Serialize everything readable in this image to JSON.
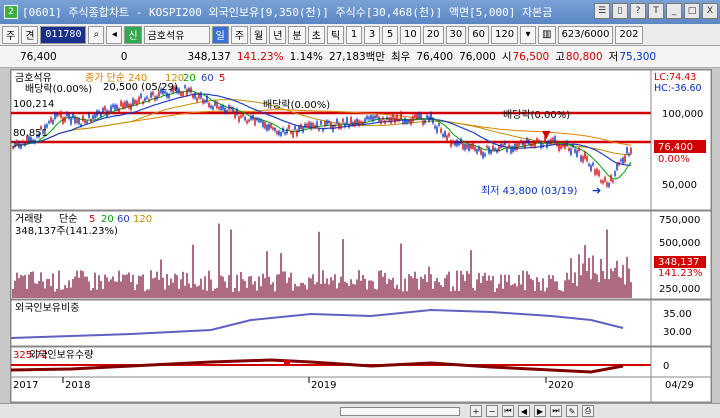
{
  "window": {
    "title": "[0601] 주식종합차트 - KOSPI200 외국인보유[9,350(천)] 주식수[30,468(천)] 액면[5,000] 자본금",
    "buttons": [
      "☰",
      "▯",
      "?",
      "T",
      "_",
      "□",
      "X"
    ]
  },
  "toolbar": {
    "market": "주",
    "mode": "견",
    "code": "011780",
    "flag": "신",
    "stock_name": "금호석유",
    "periods": [
      "일",
      "주",
      "월",
      "년",
      "분",
      "초",
      "틱"
    ],
    "active_period": "일",
    "intervals": [
      "1",
      "3",
      "5",
      "10",
      "20",
      "30",
      "60",
      "120"
    ],
    "count": "623",
    "count_max": "/6000",
    "right_label": "202"
  },
  "info": {
    "price": "76,400",
    "change": "0",
    "volume": "348,137",
    "volume_pct": "141.23%",
    "turnover": "1.14%",
    "amount": "27,183백만",
    "last_label": "최우",
    "last": "76,400",
    "last2": "76,000",
    "open_label": "시",
    "open": "76,500",
    "high_label": "고",
    "high": "80,800",
    "low_label": "저",
    "low": "75,300"
  },
  "panels": {
    "price": {
      "legend_name": "금호석유",
      "legend_ma_label": "종가 단순 240",
      "legend_ma": [
        "120",
        "20",
        "60",
        "5"
      ],
      "left_labels": [
        "100,214",
        "80,851"
      ],
      "annotations": {
        "div1": "배당락(0.00%)",
        "div1_val": "20,500 (05/29)",
        "div2": "배당락(0.00%)",
        "div3": "배당락(0.00%)",
        "low": "최저 43,800 (03/19)"
      },
      "right_labels": [
        "LC:74.43",
        "HC:-36.60",
        "100,000",
        "76,400",
        "0.00%",
        "50,000"
      ]
    },
    "volume": {
      "legend_name": "거래량",
      "legend_ma_label": "단순",
      "legend_ma": [
        "5",
        "20",
        "60",
        "120"
      ],
      "value_label": "348,137주(141.23%)",
      "right_labels": [
        "750,000",
        "500,000",
        "348,137",
        "141.23%",
        "250,000"
      ]
    },
    "foreign_pct": {
      "legend_name": "외국인보유비중",
      "right_labels": [
        "35.00",
        "30.00"
      ]
    },
    "foreign_qty": {
      "legend_name": "외국인보유수량",
      "left_label": "325.72",
      "right_labels": [
        "0"
      ]
    }
  },
  "x_axis": [
    "2017",
    "2018",
    "2019",
    "2020",
    "04/29"
  ],
  "colors": {
    "up": "#d00000",
    "down": "#0030c0",
    "ma5": "#d00000",
    "ma20": "#00a000",
    "ma60": "#2040c0",
    "ma120": "#c09000",
    "ma240": "#e08000",
    "volume_bar": "#8a2a4a",
    "foreign_pct": "#6060c0",
    "foreign_qty": "#800000"
  }
}
